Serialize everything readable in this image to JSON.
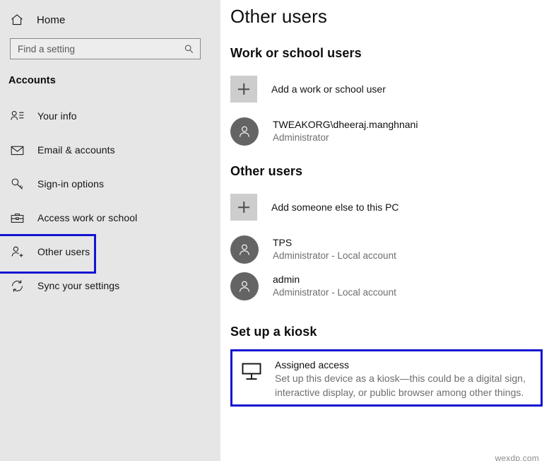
{
  "sidebar": {
    "home": {
      "label": "Home",
      "icon": "home-icon"
    },
    "search": {
      "placeholder": "Find a setting",
      "value": "",
      "icon": "search-icon"
    },
    "category": "Accounts",
    "items": [
      {
        "label": "Your info",
        "icon": "person-info-icon",
        "selected": false
      },
      {
        "label": "Email & accounts",
        "icon": "envelope-icon",
        "selected": false
      },
      {
        "label": "Sign-in options",
        "icon": "key-icon",
        "selected": false
      },
      {
        "label": "Access work or school",
        "icon": "briefcase-icon",
        "selected": false
      },
      {
        "label": "Other users",
        "icon": "person-add-icon",
        "selected": true
      },
      {
        "label": "Sync your settings",
        "icon": "sync-icon",
        "selected": false
      }
    ]
  },
  "main": {
    "title": "Other users",
    "work_school": {
      "heading": "Work or school users",
      "add_label": "Add a work or school user",
      "users": [
        {
          "name": "TWEAKORG\\dheeraj.manghnani",
          "detail": "Administrator"
        }
      ]
    },
    "other_users": {
      "heading": "Other users",
      "add_label": "Add someone else to this PC",
      "users": [
        {
          "name": "TPS",
          "detail": "Administrator - Local account"
        },
        {
          "name": "admin",
          "detail": "Administrator - Local account"
        }
      ]
    },
    "kiosk": {
      "heading": "Set up a kiosk",
      "title": "Assigned access",
      "description": "Set up this device as a kiosk—this could be a digital sign, interactive display, or public browser among other things.",
      "icon": "monitor-icon"
    }
  },
  "watermark": "wexdp.com",
  "colors": {
    "sidebar_bg": "#e6e6e6",
    "content_bg": "#ffffff",
    "highlight_border": "#1414d2",
    "avatar_bg": "#646464",
    "plus_box_bg": "#cdcdcd",
    "muted_text": "#6e6e6e"
  }
}
